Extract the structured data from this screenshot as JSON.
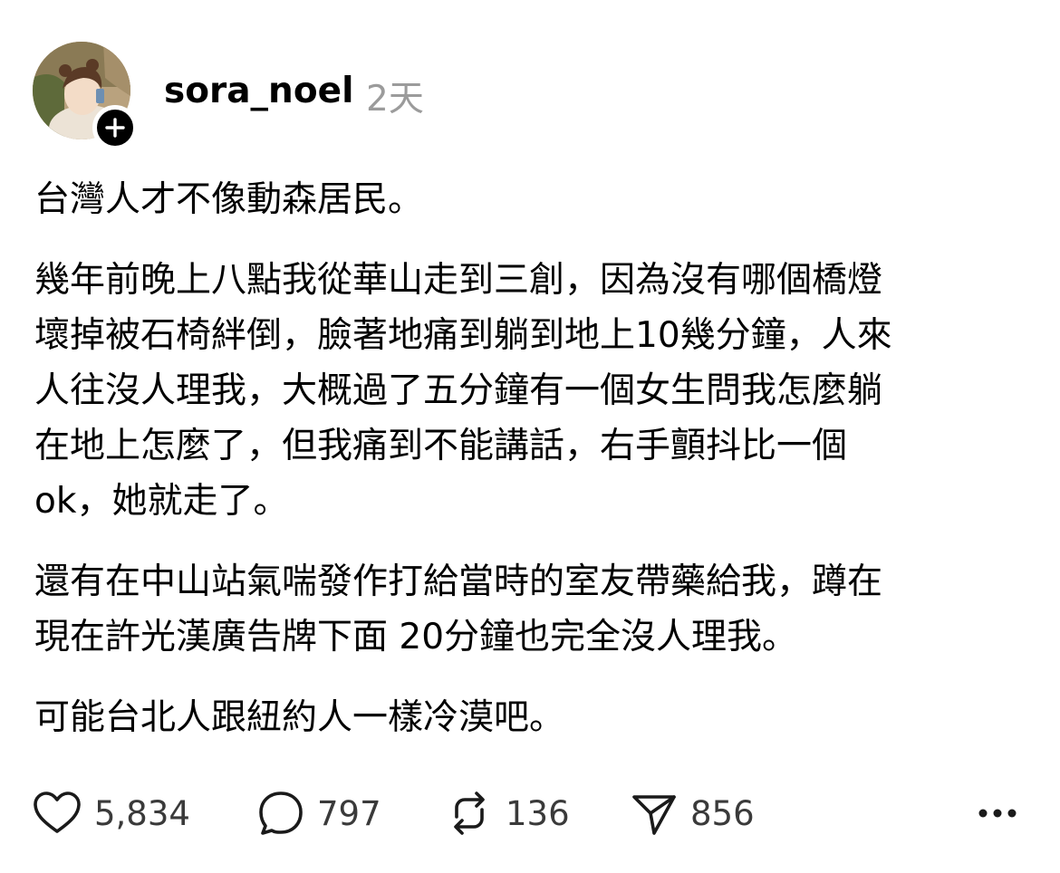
{
  "post": {
    "username": "sora_noel",
    "timestamp": "2天",
    "paragraphs": [
      "台灣人才不像動森居民。",
      "幾年前晚上八點我從華山走到三創，因為沒有哪個橋燈\n壞掉被石椅絆倒，臉著地痛到躺到地上10幾分鐘，人來\n人往沒人理我，大概過了五分鐘有一個女生問我怎麼躺\n在地上怎麼了，但我痛到不能講話，右手顫抖比一個\nok，她就走了。",
      "還有在中山站氣喘發作打給當時的室友帶藥給我，蹲在\n現在許光漢廣告牌下面 20分鐘也完全沒人理我。",
      "可能台北人跟紐約人一樣冷漠吧。"
    ]
  },
  "actions": {
    "likes": "5,834",
    "replies": "797",
    "reposts": "136",
    "shares": "856"
  },
  "icons": {
    "follow": "plus-icon",
    "like": "heart-icon",
    "reply": "comment-bubble-icon",
    "repost": "repost-icon",
    "share": "send-icon",
    "more": "more-dots-icon"
  },
  "colors": {
    "text": "#000000",
    "muted": "#9b9b9b",
    "count": "#3a3a3a"
  }
}
